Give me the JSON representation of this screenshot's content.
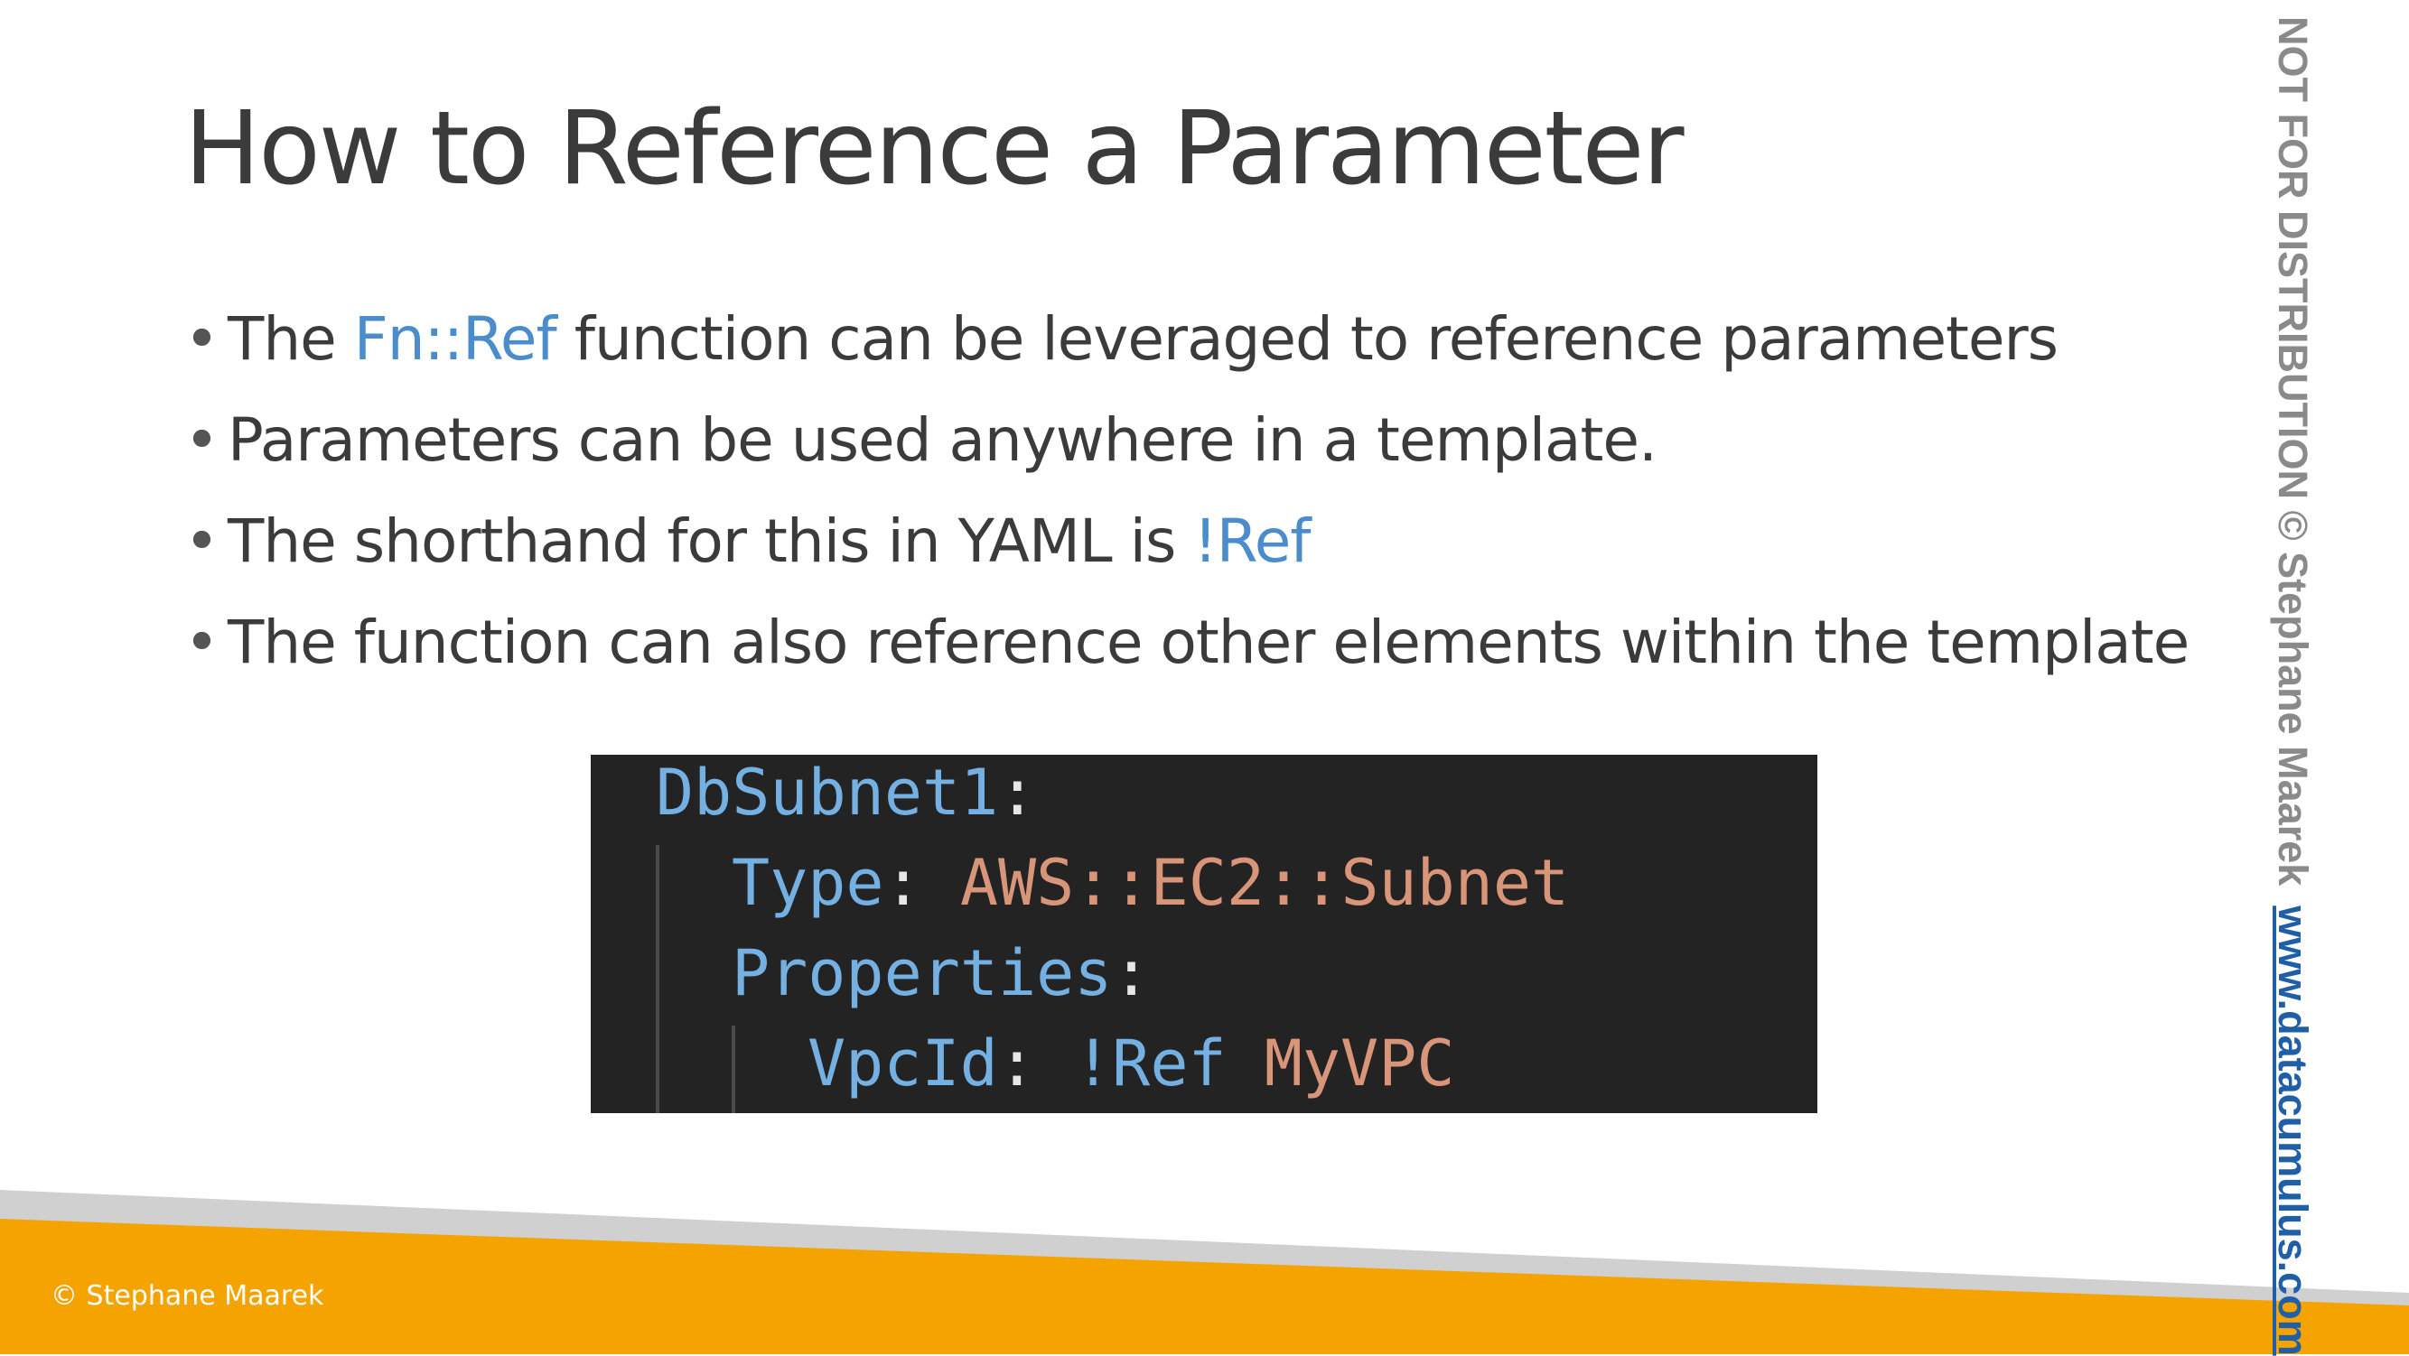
{
  "slide": {
    "title": "How to Reference a Parameter",
    "bullets": [
      {
        "before": "The ",
        "highlight": "Fn::Ref",
        "after": " function can be leveraged to reference parameters"
      },
      {
        "before": "Parameters can be used anywhere in a template.",
        "highlight": "",
        "after": ""
      },
      {
        "before": "The shorthand for this in YAML is ",
        "highlight": "!Ref",
        "after": ""
      },
      {
        "before": "The function can also reference other elements within the template",
        "highlight": "",
        "after": ""
      }
    ],
    "bullet_glyph": "•"
  },
  "code": {
    "line1_key": "DbSubnet1",
    "line2_key": "Type",
    "line2_value": "AWS::EC2::Subnet",
    "line3_key": "Properties",
    "line4_key": "VpcId",
    "line4_tag": "!Ref",
    "line4_value": "MyVPC",
    "colon": ":"
  },
  "footer": {
    "copyright": "© Stephane Maarek"
  },
  "sidebar": {
    "notice": "NOT FOR DISTRIBUTION © Stephane Maarek",
    "website": "www.datacumulus.com"
  },
  "colors": {
    "accent_blue": "#4a8ccc",
    "footer_orange": "#f5a300",
    "footer_gray": "#d0d0d0",
    "code_background": "#232323"
  }
}
